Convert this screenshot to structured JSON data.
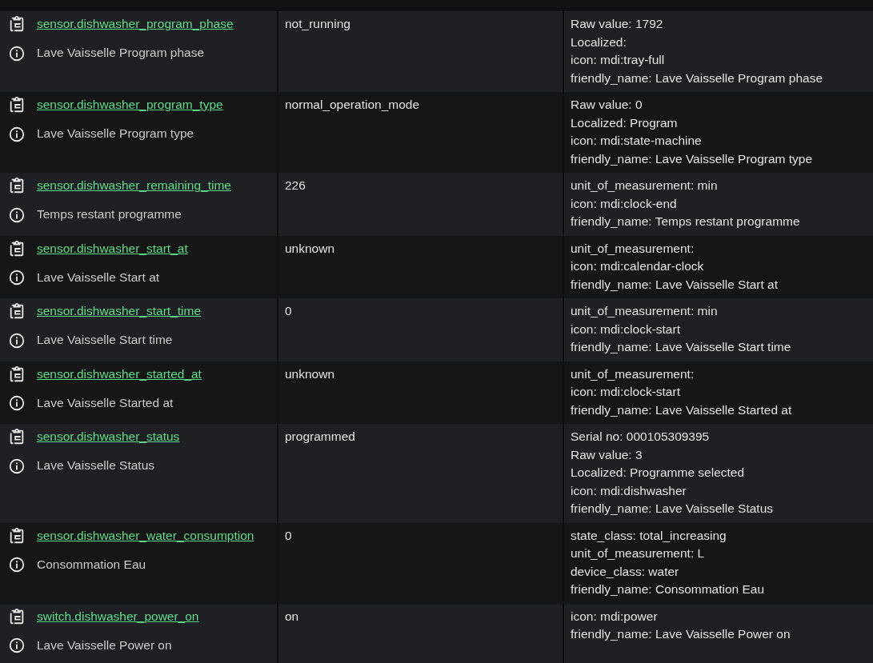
{
  "rows": [
    {
      "entity_id": "sensor.dishwasher_program_phase",
      "name": "Lave Vaisselle Program phase",
      "state": "not_running",
      "attributes": [
        "Raw value: 1792",
        "Localized:",
        "icon: mdi:tray-full",
        "friendly_name: Lave Vaisselle Program phase"
      ]
    },
    {
      "entity_id": "sensor.dishwasher_program_type",
      "name": "Lave Vaisselle Program type",
      "state": "normal_operation_mode",
      "attributes": [
        "Raw value: 0",
        "Localized: Program",
        "icon: mdi:state-machine",
        "friendly_name: Lave Vaisselle Program type"
      ]
    },
    {
      "entity_id": "sensor.dishwasher_remaining_time",
      "name": "Temps restant programme",
      "state": "226",
      "attributes": [
        "unit_of_measurement: min",
        "icon: mdi:clock-end",
        "friendly_name: Temps restant programme"
      ]
    },
    {
      "entity_id": "sensor.dishwasher_start_at",
      "name": "Lave Vaisselle Start at",
      "state": "unknown",
      "attributes": [
        "unit_of_measurement:",
        "icon: mdi:calendar-clock",
        "friendly_name: Lave Vaisselle Start at"
      ]
    },
    {
      "entity_id": "sensor.dishwasher_start_time",
      "name": "Lave Vaisselle Start time",
      "state": "0",
      "attributes": [
        "unit_of_measurement: min",
        "icon: mdi:clock-start",
        "friendly_name: Lave Vaisselle Start time"
      ]
    },
    {
      "entity_id": "sensor.dishwasher_started_at",
      "name": "Lave Vaisselle Started at",
      "state": "unknown",
      "attributes": [
        "unit_of_measurement:",
        "icon: mdi:clock-start",
        "friendly_name: Lave Vaisselle Started at"
      ]
    },
    {
      "entity_id": "sensor.dishwasher_status",
      "name": "Lave Vaisselle Status",
      "state": "programmed",
      "attributes": [
        "Serial no: 000105309395",
        "Raw value: 3",
        "Localized: Programme selected",
        "icon: mdi:dishwasher",
        "friendly_name: Lave Vaisselle Status"
      ]
    },
    {
      "entity_id": "sensor.dishwasher_water_consumption",
      "name": "Consommation Eau",
      "state": "0",
      "attributes": [
        "state_class: total_increasing",
        "unit_of_measurement: L",
        "device_class: water",
        "friendly_name: Consommation Eau"
      ]
    },
    {
      "entity_id": "switch.dishwasher_power_on",
      "name": "Lave Vaisselle Power on",
      "state": "on",
      "attributes": [
        "icon: mdi:power",
        "friendly_name: Lave Vaisselle Power on"
      ]
    }
  ]
}
